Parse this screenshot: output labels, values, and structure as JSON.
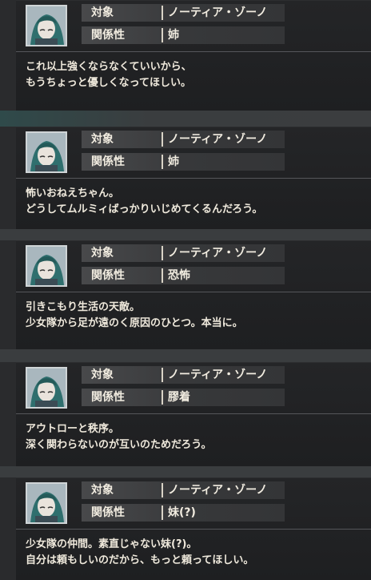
{
  "labels": {
    "target": "対象",
    "relation": "関係性"
  },
  "entries": [
    {
      "avatar_icon": "character-portrait-icon",
      "target": "ノーティア・ゾーノ",
      "relation": "姉",
      "line1": "これ以上強くならなくていいから、",
      "line2": "もうちょっと優しくなってほしい。"
    },
    {
      "avatar_icon": "character-portrait-icon",
      "target": "ノーティア・ゾーノ",
      "relation": "姉",
      "line1": "怖いおねえちゃん。",
      "line2": "どうしてムルミィばっかりいじめてくるんだろう。"
    },
    {
      "avatar_icon": "character-portrait-icon",
      "target": "ノーティア・ゾーノ",
      "relation": "恐怖",
      "line1": "引きこもり生活の天敵。",
      "line2": "少女隊から足が遠のく原因のひとつ。本当に。"
    },
    {
      "avatar_icon": "character-portrait-icon",
      "target": "ノーティア・ゾーノ",
      "relation": "膠着",
      "line1": "アウトローと秩序。",
      "line2": "深く関わらないのが互いのためだろう。"
    },
    {
      "avatar_icon": "character-portrait-icon",
      "target": "ノーティア・ゾーノ",
      "relation": "妹(?)",
      "line1": "少女隊の仲間。素直じゃない妹(?)。",
      "line2": "自分は頼もしいのだから、もっと頼ってほしい。"
    }
  ],
  "colors": {
    "background": "#2a2b2d",
    "card": "#222325",
    "text": "#ece6d8",
    "label_bg": "#48494b",
    "hair": "#2f6f6e"
  }
}
